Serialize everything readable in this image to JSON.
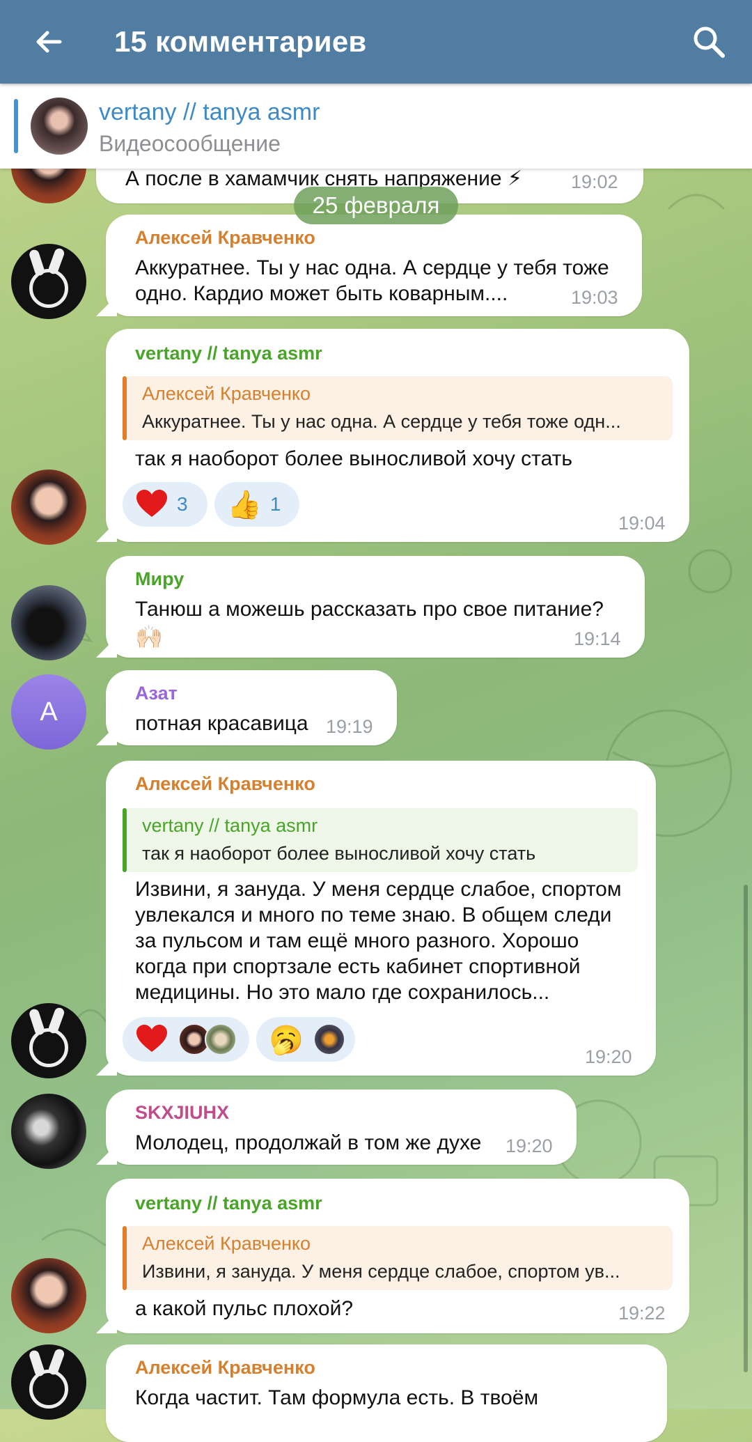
{
  "header": {
    "title": "15 комментариев",
    "back_icon": "arrow-left-icon",
    "search_icon": "search-icon"
  },
  "pinned": {
    "name": "vertany // tanya asmr",
    "subtitle": "Видеосообщение"
  },
  "date_separator": "25 февраля",
  "messages": [
    {
      "id": "m0",
      "text": "А после в хамамчик снять напряжение ⚡",
      "time": "19:02"
    },
    {
      "id": "m1",
      "author": "Алексей Кравченко",
      "text": [
        "Аккуратнее. Ты у нас одна. А сердце у тебя тоже",
        "одно. Кардио может быть коварным...."
      ],
      "time": "19:03"
    },
    {
      "id": "m2",
      "author": "vertany // tanya asmr",
      "reply": {
        "author": "Алексей Кравченко",
        "text": "Аккуратнее. Ты у нас одна. А сердце у тебя тоже одн..."
      },
      "text": "так я наоборот более выносливой хочу стать",
      "reactions": [
        {
          "emoji": "heart",
          "count": "3"
        },
        {
          "emoji": "👍",
          "count": "1"
        }
      ],
      "time": "19:04"
    },
    {
      "id": "m3",
      "author": "Миру",
      "text": "Танюш а можешь рассказать про свое питание?",
      "emoji": "🙌🏻",
      "time": "19:14"
    },
    {
      "id": "m4",
      "author": "Азат",
      "avatar_letter": "А",
      "text": "потная красавица",
      "time": "19:19"
    },
    {
      "id": "m5",
      "author": "Алексей Кравченко",
      "reply": {
        "author": "vertany // tanya asmr",
        "text": "так я наоборот более выносливой хочу стать"
      },
      "text": [
        "Извини, я зануда. У меня сердце слабое, спортом",
        "увлекался и много по теме знаю. В общем следи",
        "за пульсом и там ещё много разного. Хорошо",
        "когда при спортзале есть кабинет спортивной",
        "медицины. Но это мало где сохранилось..."
      ],
      "reactions": [
        {
          "emoji": "heart"
        },
        {
          "emoji": "🥱"
        }
      ],
      "time": "19:20"
    },
    {
      "id": "m6",
      "author": "SKXJIUHX",
      "text": "Молодец, продолжай в том же духе",
      "time": "19:20"
    },
    {
      "id": "m7",
      "author": "vertany // tanya asmr",
      "reply": {
        "author": "Алексей Кравченко",
        "text": "Извини, я зануда. У меня сердце слабое, спортом ув..."
      },
      "text": "а какой пульс плохой?",
      "time": "19:22"
    },
    {
      "id": "m8",
      "author": "Алексей Кравченко",
      "text": "Когда частит. Там формула есть. В твоём"
    }
  ]
}
